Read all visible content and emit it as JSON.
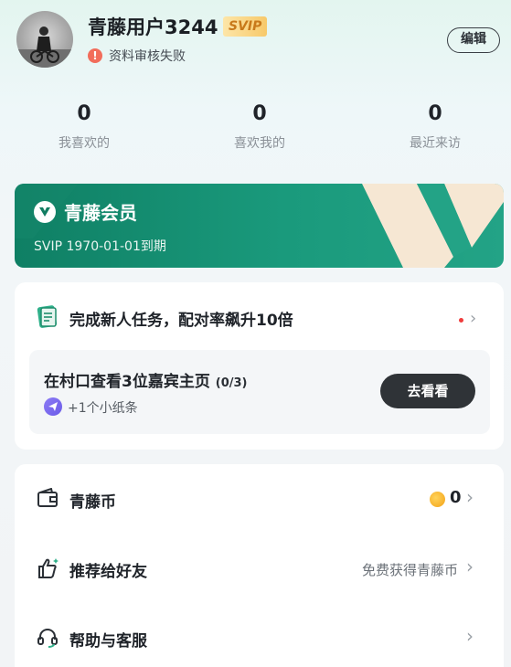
{
  "profile": {
    "username": "青藤用户3244",
    "badge": "SVIP",
    "status": "资料审核失败",
    "edit_label": "编辑",
    "avatar_icon": "user-avatar"
  },
  "stats": [
    {
      "value": "0",
      "label": "我喜欢的"
    },
    {
      "value": "0",
      "label": "喜欢我的"
    },
    {
      "value": "0",
      "label": "最近来访"
    }
  ],
  "vip": {
    "title": "青藤会员",
    "expire": "SVIP 1970-01-01到期",
    "accent": "#1a9a7c"
  },
  "task": {
    "title": "完成新人任务，配对率飙升10倍",
    "subtask_title": "在村口查看3位嘉宾主页",
    "subtask_progress": "(0/3)",
    "reward": "+1个小纸条",
    "go_label": "去看看"
  },
  "menu": [
    {
      "label": "青藤币",
      "icon": "wallet-icon",
      "value": "0"
    },
    {
      "label": "推荐给好友",
      "icon": "thumbs-up-icon",
      "right_text": "免费获得青藤币"
    },
    {
      "label": "帮助与客服",
      "icon": "headset-icon"
    }
  ],
  "colors": {
    "brand_green": "#1a9a7c",
    "warning": "#f26d5b",
    "svip_gold": "#f7c96a"
  }
}
